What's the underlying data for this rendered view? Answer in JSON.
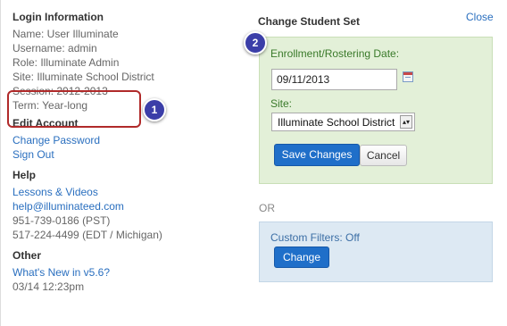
{
  "login": {
    "title": "Login Information",
    "name": "Name: User Illuminate",
    "username": "Username: admin",
    "role": "Role: Illuminate Admin",
    "site": "Site: Illuminate School District",
    "session": "Session: 2012-2013",
    "term": "Term: Year-long"
  },
  "edit_account": {
    "title": "Edit Account",
    "change_password": "Change Password",
    "sign_out": "Sign Out"
  },
  "help": {
    "title": "Help",
    "lessons": "Lessons & Videos",
    "email": "help@illuminateed.com",
    "phone_pst": "951-739-0186 (PST)",
    "phone_edt": "517-224-4499 (EDT / Michigan)"
  },
  "other": {
    "title": "Other",
    "whats_new": "What's New in v5.6?",
    "timestamp": "03/14 12:23pm"
  },
  "callouts": {
    "one": "1",
    "two": "2"
  },
  "student_set": {
    "title": "Change Student Set",
    "close": "Close",
    "date_label": "Enrollment/Rostering Date:",
    "date_value": "09/11/2013",
    "site_label": "Site:",
    "site_value": "Illuminate School District",
    "save": "Save Changes",
    "cancel": "Cancel"
  },
  "or_text": "OR",
  "filters": {
    "label": "Custom Filters: Off",
    "change": "Change"
  }
}
